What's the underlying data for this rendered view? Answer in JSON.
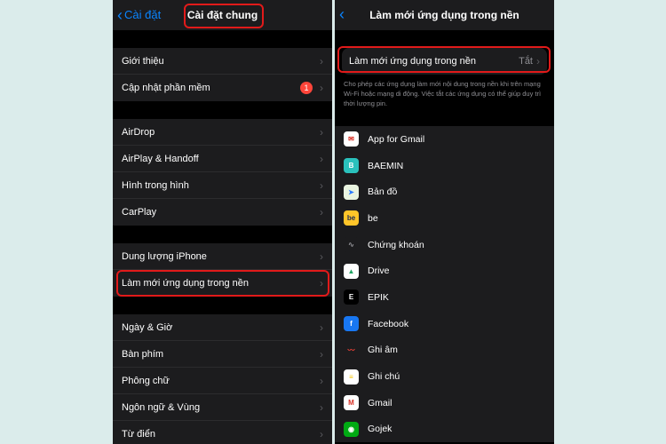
{
  "left": {
    "back_label": "Cài đặt",
    "title": "Cài đặt chung",
    "group1": [
      {
        "label": "Giới thiệu"
      },
      {
        "label": "Cập nhật phần mềm",
        "badge": "1"
      }
    ],
    "group2": [
      {
        "label": "AirDrop"
      },
      {
        "label": "AirPlay & Handoff"
      },
      {
        "label": "Hình trong hình"
      },
      {
        "label": "CarPlay"
      }
    ],
    "group3": [
      {
        "label": "Dung lượng iPhone"
      },
      {
        "label": "Làm mới ứng dụng trong nền"
      }
    ],
    "group4": [
      {
        "label": "Ngày & Giờ"
      },
      {
        "label": "Bàn phím"
      },
      {
        "label": "Phông chữ"
      },
      {
        "label": "Ngôn ngữ & Vùng"
      },
      {
        "label": "Từ điển"
      }
    ]
  },
  "right": {
    "title": "Làm mới ứng dụng trong nền",
    "setting": {
      "label": "Làm mới ứng dụng trong nền",
      "value": "Tắt"
    },
    "description": "Cho phép các ứng dụng làm mới nội dung trong nền khi trên mạng Wi-Fi hoặc mạng di động. Việc tắt các ứng dụng có thể giúp duy trì thời lượng pin.",
    "apps": [
      {
        "name": "App for Gmail",
        "icon": "app-for-gmail-icon",
        "color": "#ffffff"
      },
      {
        "name": "BAEMIN",
        "icon": "baemin-icon",
        "color": "#2ac1bc"
      },
      {
        "name": "Bản đồ",
        "icon": "maps-icon",
        "color": "#e9f4e0"
      },
      {
        "name": "be",
        "icon": "be-icon",
        "color": "#ffc529"
      },
      {
        "name": "Chứng khoán",
        "icon": "stocks-icon",
        "color": "#1c1c1e"
      },
      {
        "name": "Drive",
        "icon": "drive-icon",
        "color": "#ffffff"
      },
      {
        "name": "EPIK",
        "icon": "epik-icon",
        "color": "#000000"
      },
      {
        "name": "Facebook",
        "icon": "facebook-icon",
        "color": "#1877f2"
      },
      {
        "name": "Ghi âm",
        "icon": "voice-memo-icon",
        "color": "#1c1c1e"
      },
      {
        "name": "Ghi chú",
        "icon": "notes-icon",
        "color": "#ffffff"
      },
      {
        "name": "Gmail",
        "icon": "gmail-icon",
        "color": "#ffffff"
      },
      {
        "name": "Gojek",
        "icon": "gojek-icon",
        "color": "#00aa13"
      }
    ]
  },
  "colors": {
    "accent": "#0a84ff",
    "highlight": "#e11a1a",
    "badge": "#ff453a"
  }
}
